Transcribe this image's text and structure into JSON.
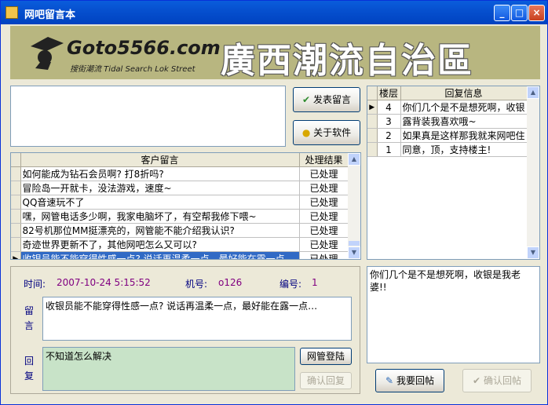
{
  "window": {
    "title": "网吧留言本"
  },
  "banner": {
    "site": "Goto5566.com",
    "sub": "搜街潮流 Tidal Search Lok Street",
    "headline": "廣西潮流自治區"
  },
  "buttons": {
    "post": "发表留言",
    "about": "关于软件",
    "admin_login": "网管登陆",
    "confirm_reply": "确认回复",
    "want_reply": "我要回帖",
    "confirm_post": "确认回帖"
  },
  "messages": {
    "columns": [
      "客户留言",
      "处理结果"
    ],
    "rows": [
      {
        "text": "如何能成为钻石会员啊? 打8折吗?",
        "status": "已处理"
      },
      {
        "text": "冒险岛一开就卡，没法游戏，速度~",
        "status": "已处理"
      },
      {
        "text": "QQ音速玩不了",
        "status": "已处理"
      },
      {
        "text": "嘿，网管电话多少啊，我家电脑坏了，有空帮我修下喂~",
        "status": "已处理"
      },
      {
        "text": "82号机那位MM挺漂亮的，网管能不能介绍我认识?",
        "status": "已处理"
      },
      {
        "text": "奇迹世界更新不了，其他网吧怎么又可以?",
        "status": "已处理"
      },
      {
        "text": "收银员能不能穿得性感一点? 说话再温柔一点，最好能在露一点…",
        "status": "已处理"
      }
    ]
  },
  "replies": {
    "columns": [
      "楼层",
      "回复信息"
    ],
    "rows": [
      {
        "floor": "4",
        "text": "你们几个是不是想死啊，收银"
      },
      {
        "floor": "3",
        "text": "露背装我喜欢哦~"
      },
      {
        "floor": "2",
        "text": "如果真是这样那我就来网吧住"
      },
      {
        "floor": "1",
        "text": "同意，顶，支持楼主!"
      }
    ]
  },
  "detail": {
    "time_label": "时间:",
    "time": "2007-10-24 5:15:52",
    "machine_label": "机号:",
    "machine": "o126",
    "id_label": "编号:",
    "id": "1",
    "message_label_1": "留",
    "message_label_2": "言",
    "message": "收银员能不能穿得性感一点? 说话再温柔一点，最好能在露一点…",
    "reply_label_1": "回",
    "reply_label_2": "复",
    "reply": "不知道怎么解决"
  },
  "reply_detail": {
    "text": "你们几个是不是想死啊，收银是我老婆!!"
  }
}
